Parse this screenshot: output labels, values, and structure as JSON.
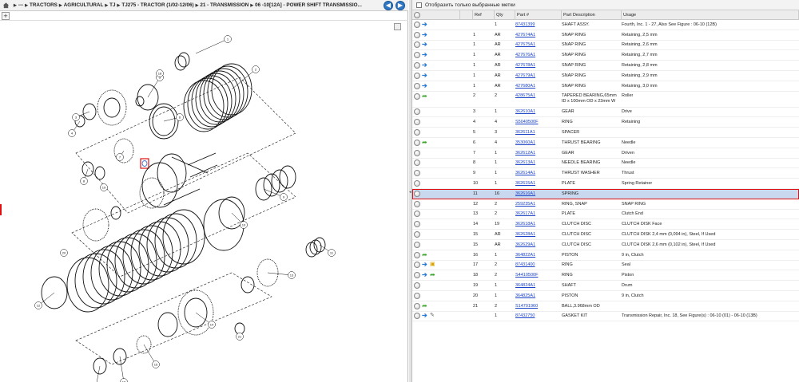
{
  "breadcrumb": {
    "items": [
      "---",
      "TRACTORS",
      "AGRICULTURAL",
      "TJ",
      "TJ275 - TRACTOR (1/02-12/06)",
      "21 - TRANSMISSION",
      "06 -10[12A] - POWER SHIFT TRANSMISSIO..."
    ]
  },
  "nav": {
    "back": "◀",
    "forward": "▶"
  },
  "filter": {
    "label": "Отобразить только выбранные метки"
  },
  "table": {
    "headers": [
      "Ref",
      "Qty",
      "Part #",
      "Part Description",
      "Usage"
    ],
    "rows": [
      {
        "ref": "",
        "qty": "1",
        "part": "87431399",
        "desc": "SHAFT ASSY.",
        "usage": "Fourth, Inc. 1 - 27, Also See Figure : 06-10 (12B)",
        "icons": [
          "circle",
          "info"
        ]
      },
      {
        "ref": "1",
        "qty": "AR",
        "part": "427674A1",
        "desc": "SNAP RING",
        "usage": "Retaining, 2,5 mm",
        "icons": [
          "circle",
          "info"
        ]
      },
      {
        "ref": "1",
        "qty": "AR",
        "part": "427675A1",
        "desc": "SNAP RING",
        "usage": "Retaining, 2,6 mm",
        "icons": [
          "circle",
          "info"
        ]
      },
      {
        "ref": "1",
        "qty": "AR",
        "part": "427676A1",
        "desc": "SNAP RING",
        "usage": "Retaining, 2,7 mm",
        "icons": [
          "circle",
          "info"
        ]
      },
      {
        "ref": "1",
        "qty": "AR",
        "part": "427678A1",
        "desc": "SNAP RING",
        "usage": "Retaining, 2,8 mm",
        "icons": [
          "circle",
          "info"
        ]
      },
      {
        "ref": "1",
        "qty": "AR",
        "part": "427679A1",
        "desc": "SNAP RING",
        "usage": "Retaining, 2,9 mm",
        "icons": [
          "circle",
          "info"
        ]
      },
      {
        "ref": "1",
        "qty": "AR",
        "part": "427680A1",
        "desc": "SNAP RING",
        "usage": "Retaining, 3,0 mm",
        "icons": [
          "circle",
          "info"
        ]
      },
      {
        "ref": "2",
        "qty": "2",
        "part": "428675A1",
        "desc": "TAPERED BEARING,65mm ID x 100mm OD x 23mm W",
        "usage": "Roller",
        "icons": [
          "circle",
          "arrow"
        ],
        "tall": true
      },
      {
        "ref": "3",
        "qty": "1",
        "part": "362610A1",
        "desc": "GEAR",
        "usage": "Drive",
        "icons": [
          "circle"
        ]
      },
      {
        "ref": "4",
        "qty": "4",
        "part": "S5040500F",
        "desc": "RING",
        "usage": "Retaining",
        "icons": [
          "circle"
        ]
      },
      {
        "ref": "5",
        "qty": "3",
        "part": "362611A1",
        "desc": "SPACER",
        "usage": "",
        "icons": [
          "circle"
        ]
      },
      {
        "ref": "6",
        "qty": "4",
        "part": "353060A1",
        "desc": "THRUST BEARING",
        "usage": "Needle",
        "icons": [
          "circle",
          "arrow"
        ]
      },
      {
        "ref": "7",
        "qty": "1",
        "part": "362612A1",
        "desc": "GEAR",
        "usage": "Driven",
        "icons": [
          "circle"
        ]
      },
      {
        "ref": "8",
        "qty": "1",
        "part": "362613A1",
        "desc": "NEEDLE BEARING",
        "usage": "Needle",
        "icons": [
          "circle"
        ]
      },
      {
        "ref": "9",
        "qty": "1",
        "part": "362614A1",
        "desc": "THRUST WASHER",
        "usage": "Thrust",
        "icons": [
          "circle"
        ]
      },
      {
        "ref": "10",
        "qty": "1",
        "part": "362615A1",
        "desc": "PLATE",
        "usage": "Spring Retainer",
        "icons": [
          "circle"
        ]
      },
      {
        "ref": "11",
        "qty": "16",
        "part": "362616A1",
        "desc": "SPRING",
        "usage": "",
        "icons": [
          "circle"
        ],
        "selected": true
      },
      {
        "ref": "12",
        "qty": "2",
        "part": "259235A1",
        "desc": "RING, SNAP",
        "usage": "SNAP RING",
        "icons": [
          "circle"
        ]
      },
      {
        "ref": "13",
        "qty": "2",
        "part": "362617A1",
        "desc": "PLATE",
        "usage": "Clutch End",
        "icons": [
          "circle"
        ]
      },
      {
        "ref": "14",
        "qty": "19",
        "part": "362618A1",
        "desc": "CLUTCH DISC",
        "usage": "CLUTCH DISK Face",
        "icons": [
          "circle"
        ]
      },
      {
        "ref": "15",
        "qty": "AR",
        "part": "362628A1",
        "desc": "CLUTCH DISC",
        "usage": "CLUTCH DISK 2,4 mm (0,094 in), Steel, If Used",
        "icons": [
          "circle"
        ]
      },
      {
        "ref": "15",
        "qty": "AR",
        "part": "362629A1",
        "desc": "CLUTCH DISC",
        "usage": "CLUTCH DISK 2,6 mm (0,102 in), Steel, If Used",
        "icons": [
          "circle"
        ]
      },
      {
        "ref": "16",
        "qty": "1",
        "part": "364822A1",
        "desc": "PISTON",
        "usage": "9 in, Clutch",
        "icons": [
          "circle",
          "arrow"
        ]
      },
      {
        "ref": "17",
        "qty": "2",
        "part": "87431400",
        "desc": "RING",
        "usage": "Seal",
        "icons": [
          "circle",
          "info",
          "box"
        ]
      },
      {
        "ref": "18",
        "qty": "2",
        "part": "S4410500F",
        "desc": "RING",
        "usage": "Piston",
        "icons": [
          "circle",
          "info",
          "arrow"
        ]
      },
      {
        "ref": "19",
        "qty": "1",
        "part": "364824A1",
        "desc": "SHAFT",
        "usage": "Drum",
        "icons": [
          "circle"
        ]
      },
      {
        "ref": "20",
        "qty": "1",
        "part": "364825A1",
        "desc": "PISTON",
        "usage": "9 in, Clutch",
        "icons": [
          "circle"
        ]
      },
      {
        "ref": "21",
        "qty": "2",
        "part": "S14701960",
        "desc": "BALL,3.968mm OD",
        "usage": "",
        "icons": [
          "circle",
          "arrow"
        ]
      },
      {
        "ref": "",
        "qty": "1",
        "part": "87432750",
        "desc": "GASKET KIT",
        "usage": "Transmission Repair, Inc. 18, See Figure(s) : 06-10 (01) - 06-10 (13B)",
        "icons": [
          "circle",
          "info",
          "wrench"
        ]
      }
    ]
  },
  "diagram_labels": [
    "1",
    "2",
    "3",
    "4",
    "5",
    "6",
    "7",
    "8",
    "9",
    "10",
    "11",
    "12",
    "13",
    "14",
    "15",
    "16",
    "17",
    "18",
    "19",
    "20",
    "21"
  ]
}
